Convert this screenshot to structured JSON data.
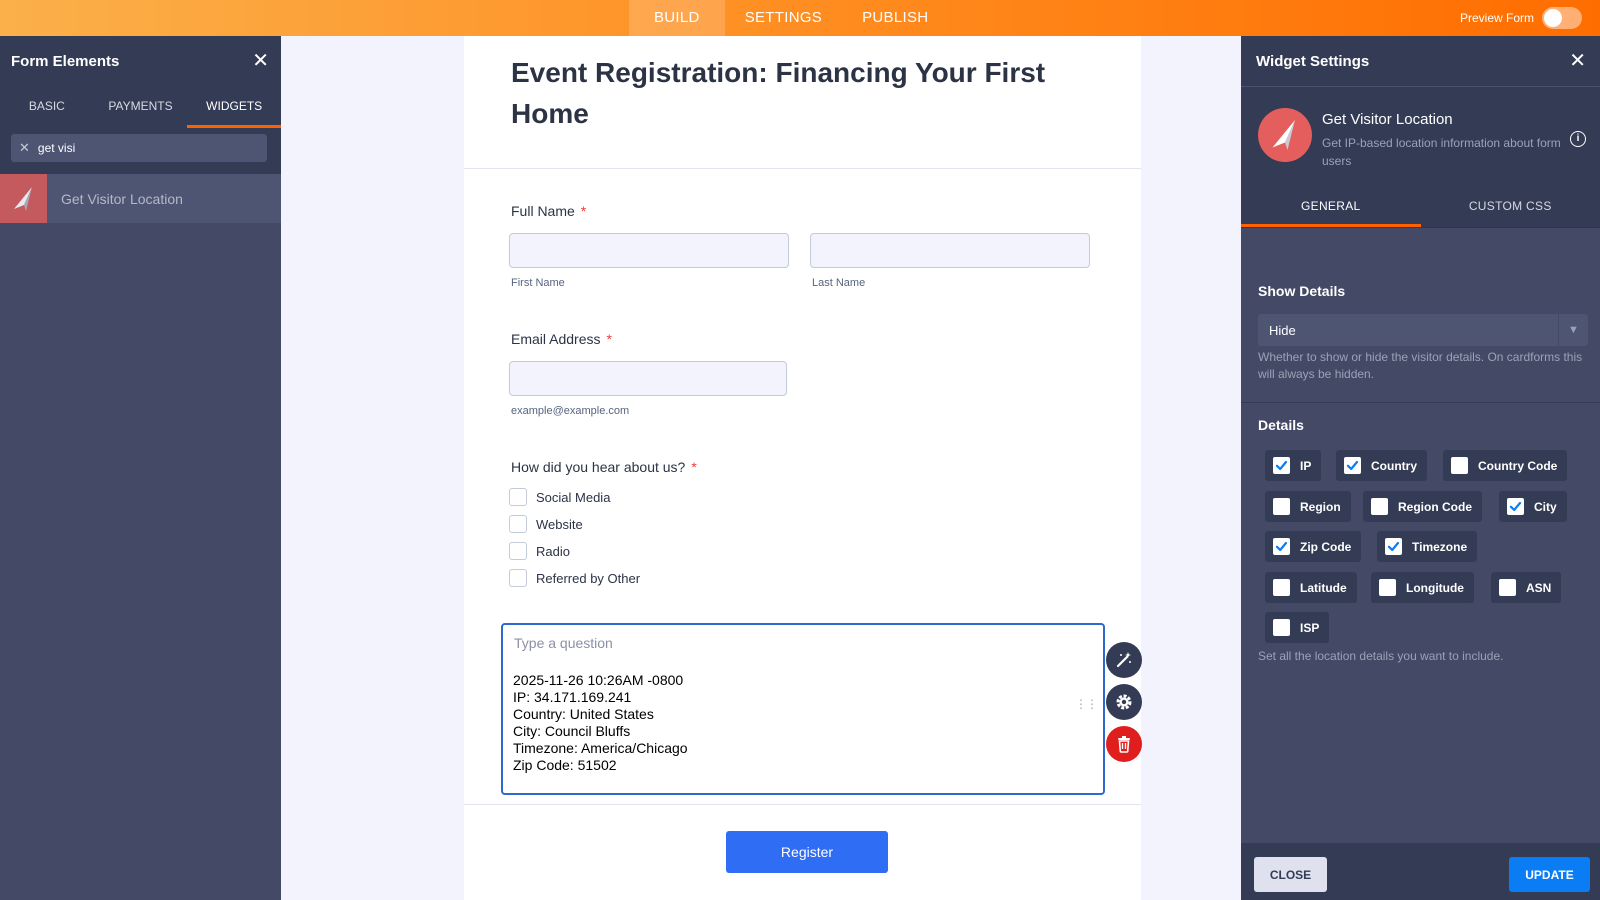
{
  "topbar": {
    "tabs": [
      {
        "label": "BUILD",
        "active": true
      },
      {
        "label": "SETTINGS",
        "active": false
      },
      {
        "label": "PUBLISH",
        "active": false
      }
    ],
    "preview_label": "Preview Form",
    "preview_enabled": false
  },
  "left_panel": {
    "title": "Form Elements",
    "tabs": [
      "BASIC",
      "PAYMENTS",
      "WIDGETS"
    ],
    "active_tab": "WIDGETS",
    "search_value": "get visi",
    "results": [
      {
        "label": "Get Visitor Location",
        "icon": "location-arrow-icon"
      }
    ]
  },
  "form": {
    "title": "Event Registration: Financing Your First Home",
    "full_name": {
      "label": "Full Name",
      "required_mark": "*",
      "first_sub": "First Name",
      "last_sub": "Last Name"
    },
    "email": {
      "label": "Email Address",
      "required_mark": "*",
      "sub": "example@example.com"
    },
    "hear": {
      "label": "How did you hear about us?",
      "required_mark": "*",
      "options": [
        "Social Media",
        "Website",
        "Radio",
        "Referred by Other"
      ]
    },
    "question": {
      "placeholder": "Type a question",
      "lines": [
        "2025-11-26 10:26AM -0800",
        "IP: 34.171.169.241",
        "Country: United States",
        "City: Council Bluffs",
        "Timezone: America/Chicago",
        "Zip Code: 51502"
      ]
    },
    "submit_label": "Register"
  },
  "right_panel": {
    "title": "Widget Settings",
    "widget_name": "Get Visitor Location",
    "widget_desc": "Get IP-based location information about form users",
    "tabs": [
      "GENERAL",
      "CUSTOM CSS"
    ],
    "active_tab": "GENERAL",
    "show_details": {
      "label": "Show Details",
      "value": "Hide",
      "help": "Whether to show or hide the visitor details. On cardforms this will always be hidden."
    },
    "details": {
      "label": "Details",
      "items": [
        {
          "label": "IP",
          "checked": true
        },
        {
          "label": "Country",
          "checked": true
        },
        {
          "label": "Country Code",
          "checked": false
        },
        {
          "label": "Region",
          "checked": false
        },
        {
          "label": "Region Code",
          "checked": false
        },
        {
          "label": "City",
          "checked": true
        },
        {
          "label": "Zip Code",
          "checked": true
        },
        {
          "label": "Timezone",
          "checked": true
        },
        {
          "label": "Latitude",
          "checked": false
        },
        {
          "label": "Longitude",
          "checked": false
        },
        {
          "label": "ASN",
          "checked": false
        },
        {
          "label": "ISP",
          "checked": false
        }
      ],
      "help": "Set all the location details you want to include."
    },
    "close_label": "CLOSE",
    "update_label": "UPDATE"
  },
  "colors": {
    "accent": "#ff6100",
    "primary_button": "#2f6df5",
    "update_button": "#0a7cf4",
    "delete": "#e01e1e",
    "check": "#0a7cf4"
  }
}
